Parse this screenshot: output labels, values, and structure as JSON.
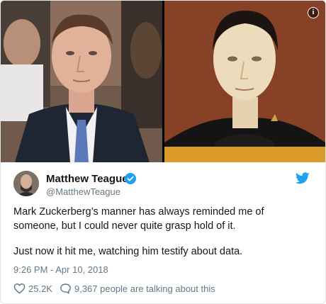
{
  "tweet": {
    "author": {
      "display_name": "Matthew Teague",
      "handle": "@MatthewTeague",
      "verified": true
    },
    "text_paragraphs": [
      "Mark Zuckerberg’s manner has always reminded me of someone, but I could never quite grasp hold of it.",
      "Just now it hit me, watching him testify about data."
    ],
    "timestamp": "9:26 PM - Apr 10, 2018",
    "likes": "25.2K",
    "replies_text": "9,367 people are talking about this",
    "icons": [
      "info-icon",
      "verified-icon",
      "twitter-bird-icon",
      "heart-icon",
      "comment-icon"
    ],
    "colors": {
      "twitter_blue": "#1da1f2",
      "secondary_text": "#657786",
      "border": "#e1e8ed"
    }
  }
}
